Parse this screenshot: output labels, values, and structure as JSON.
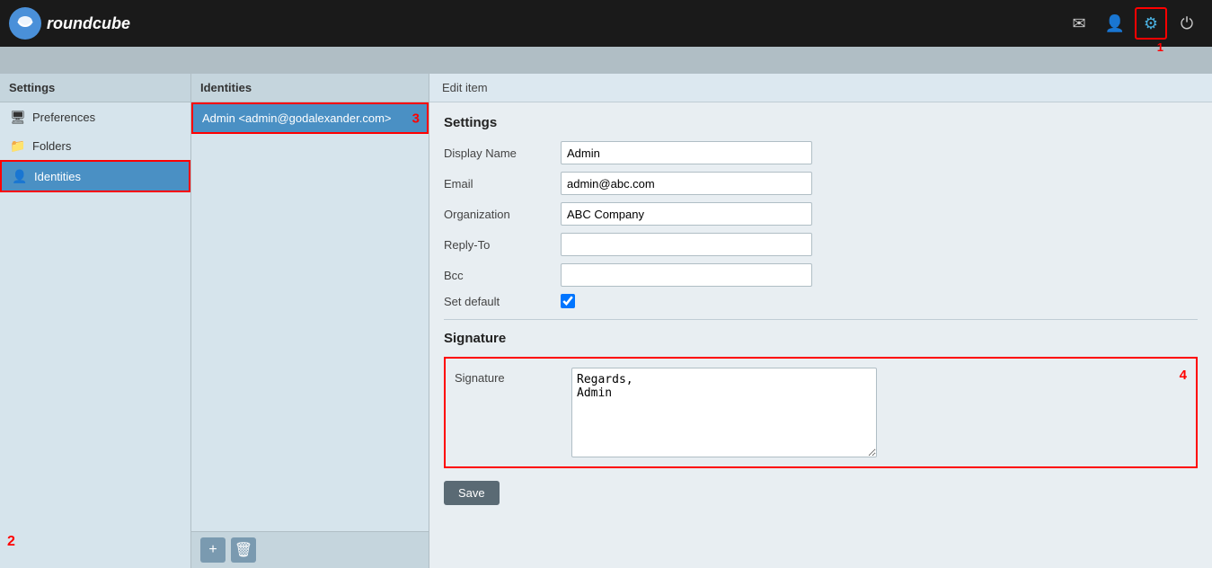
{
  "app": {
    "name": "roundcube",
    "title": "roundcube"
  },
  "topbar": {
    "mail_icon": "✉",
    "user_icon": "👤",
    "settings_icon": "⚙",
    "power_icon": "⏻"
  },
  "left_panel": {
    "header": "Settings",
    "items": [
      {
        "id": "preferences",
        "label": "Preferences",
        "icon": "🖥"
      },
      {
        "id": "folders",
        "label": "Folders",
        "icon": "📁"
      },
      {
        "id": "identities",
        "label": "Identities",
        "icon": "👤"
      }
    ]
  },
  "middle_panel": {
    "header": "Identities",
    "identity_item": "Admin <admin@godalexander.com>"
  },
  "right_panel": {
    "header": "Edit item",
    "settings_section": "Settings",
    "fields": {
      "display_name_label": "Display Name",
      "display_name_value": "Admin",
      "email_label": "Email",
      "email_value": "admin@abc.com",
      "organization_label": "Organization",
      "organization_value": "ABC Company",
      "reply_to_label": "Reply-To",
      "reply_to_value": "",
      "bcc_label": "Bcc",
      "bcc_value": "",
      "set_default_label": "Set default"
    },
    "signature_section": "Signature",
    "signature_label": "Signature",
    "signature_value": "Regards,\nAdmin",
    "save_button": "Save"
  },
  "annotations": {
    "a1": "1",
    "a2": "2",
    "a3": "3",
    "a4": "4"
  }
}
